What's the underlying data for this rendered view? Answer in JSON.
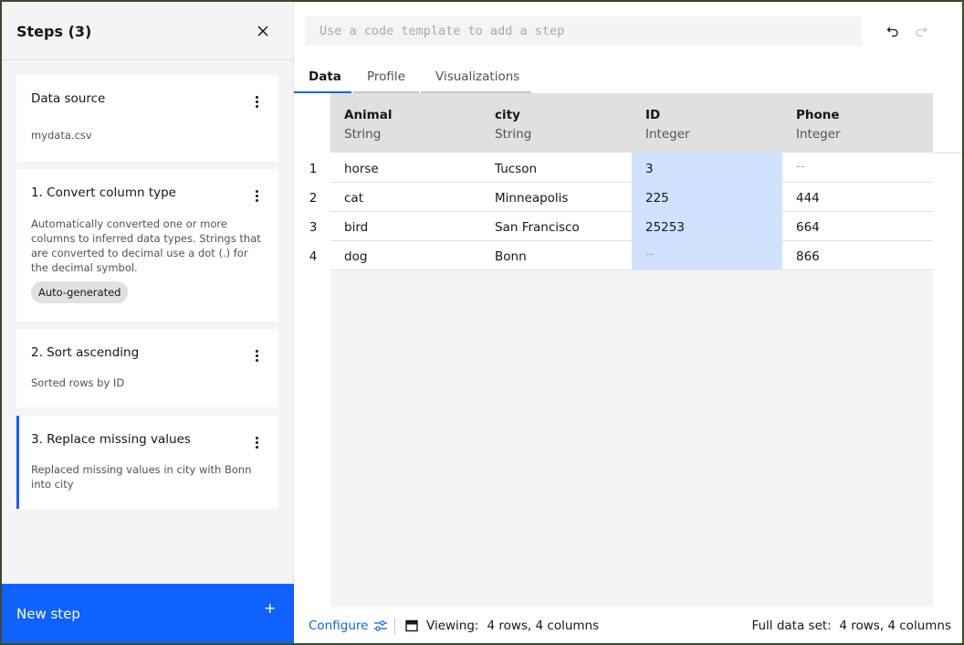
{
  "steps_panel": {
    "title": "Steps (3)",
    "cards": [
      {
        "title": "Data source",
        "description": "mydata.csv"
      },
      {
        "title": "1. Convert column type",
        "description": "Automatically converted one or more columns to inferred data types. Strings that are converted to decimal use a dot (.) for the decimal symbol.",
        "tag": "Auto-generated"
      },
      {
        "title": "2. Sort ascending",
        "description": "Sorted rows by ID"
      },
      {
        "title": "3. Replace missing values",
        "description": "Replaced missing values in city with Bonn into city"
      }
    ],
    "new_step_label": "New step",
    "plus_symbol": "+"
  },
  "search": {
    "placeholder": "Use a code template to add a step"
  },
  "tabs": [
    "Data",
    "Profile",
    "Visualizations"
  ],
  "table": {
    "columns": [
      {
        "name": "Animal",
        "type": "String"
      },
      {
        "name": "city",
        "type": "String"
      },
      {
        "name": "ID",
        "type": "Integer"
      },
      {
        "name": "Phone",
        "type": "Integer"
      }
    ],
    "row_numbers": [
      "1",
      "2",
      "3",
      "4"
    ],
    "rows": [
      [
        "horse",
        "Tucson",
        "3",
        "--"
      ],
      [
        "cat",
        "Minneapolis",
        "225",
        "444"
      ],
      [
        "bird",
        "San Francisco",
        "25253",
        "664"
      ],
      [
        "dog",
        "Bonn",
        "--",
        "866"
      ]
    ]
  },
  "footer": {
    "configure_label": "Configure",
    "viewing_label": "Viewing:",
    "viewing_value": "4 rows, 4 columns",
    "full_label": "Full data set:",
    "full_value": "4 rows, 4 columns"
  },
  "colors": {
    "accent": "#0f62fe",
    "highlight": "#d0e2ff"
  }
}
